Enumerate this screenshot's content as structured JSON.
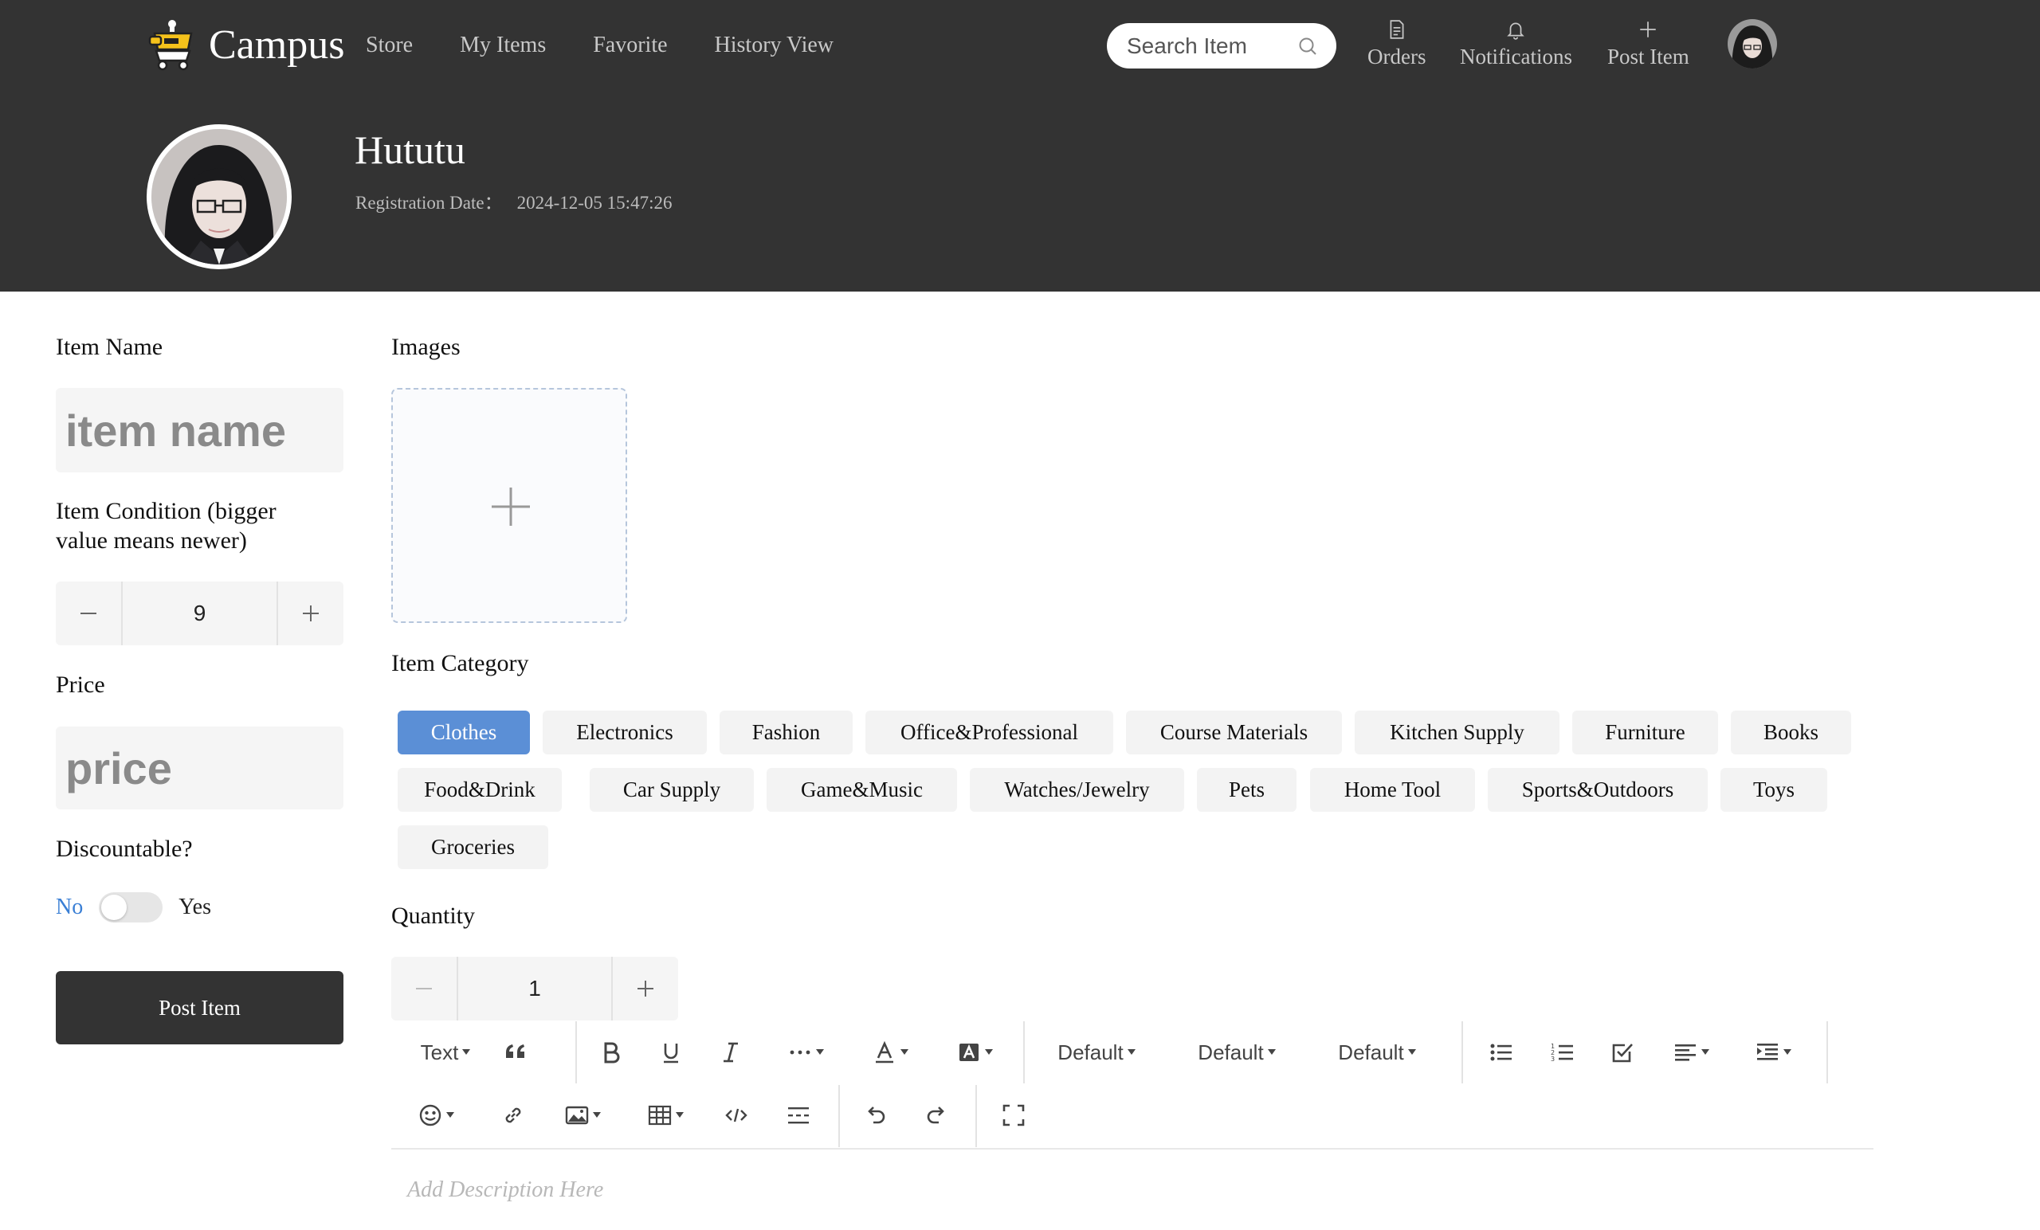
{
  "nav": {
    "brand": "Campus",
    "links": [
      "Store",
      "My Items",
      "Favorite",
      "History View"
    ],
    "search_placeholder": "Search Item",
    "orders_label": "Orders",
    "notifications_label": "Notifications",
    "post_item_label": "Post Item"
  },
  "profile": {
    "name": "Hututu",
    "registration_label": "Registration Date：",
    "registration_value": "2024-12-05 15:47:26"
  },
  "form": {
    "item_name_label": "Item Name",
    "item_name_placeholder": "item name",
    "condition_label_line1": "Item Condition (bigger",
    "condition_label_line2": "value means newer)",
    "condition_value": "9",
    "price_label": "Price",
    "price_placeholder": "price",
    "discountable_label": "Discountable?",
    "toggle_no": "No",
    "toggle_yes": "Yes",
    "discountable": false,
    "post_button": "Post Item"
  },
  "images": {
    "label": "Images"
  },
  "category": {
    "label": "Item Category",
    "selected": "Clothes",
    "items": [
      "Clothes",
      "Electronics",
      "Fashion",
      "Office&Professional",
      "Course Materials",
      "Kitchen Supply",
      "Furniture",
      "Books",
      "Food&Drink",
      "Car Supply",
      "Game&Music",
      "Watches/Jewelry",
      "Pets",
      "Home Tool",
      "Sports&Outdoors",
      "Toys",
      "Groceries"
    ]
  },
  "quantity": {
    "label": "Quantity",
    "value": "1"
  },
  "editor": {
    "text_style": "Text",
    "font_size": "Default",
    "font_family": "Default",
    "line_height": "Default",
    "placeholder": "Add Description Here"
  },
  "colors": {
    "header_bg": "#333333",
    "accent": "#5b8fd6",
    "toggle_off": "#e6e6e6"
  }
}
